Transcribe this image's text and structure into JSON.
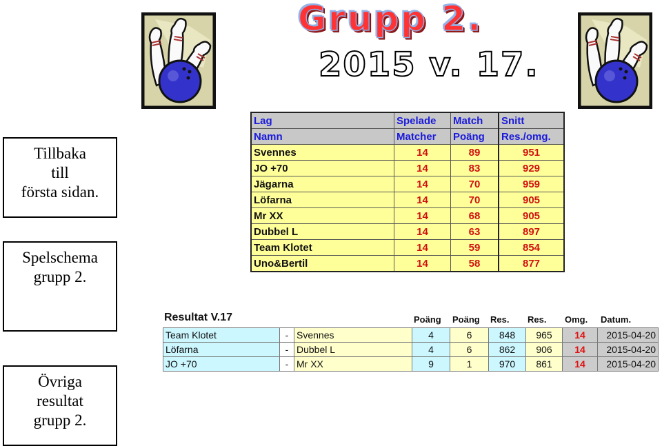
{
  "nav": {
    "back": [
      "Tillbaka",
      "till",
      "första sidan."
    ],
    "schedule": [
      "Spelschema",
      "grupp 2."
    ],
    "other_results": [
      "Övriga",
      "resultat",
      "grupp 2."
    ]
  },
  "header": {
    "title": "Grupp 2.",
    "subtitle": "2015 v. 17.",
    "clipart_icon": "bowling-ball-and-pins"
  },
  "standings": {
    "header_row1": [
      "Lag",
      "Spelade",
      "Match",
      "Snitt"
    ],
    "header_row2": [
      "Namn",
      "Matcher",
      "Poäng",
      "Res./omg."
    ],
    "rows": [
      {
        "team": "Svennes",
        "played": "14",
        "points": "89",
        "avg": "951"
      },
      {
        "team": "JO +70",
        "played": "14",
        "points": "83",
        "avg": "929"
      },
      {
        "team": "Jägarna",
        "played": "14",
        "points": "70",
        "avg": "959"
      },
      {
        "team": "Löfarna",
        "played": "14",
        "points": "70",
        "avg": "905"
      },
      {
        "team": "Mr XX",
        "played": "14",
        "points": "68",
        "avg": "905"
      },
      {
        "team": "Dubbel L",
        "played": "14",
        "points": "63",
        "avg": "897"
      },
      {
        "team": "Team Klotet",
        "played": "14",
        "points": "59",
        "avg": "854"
      },
      {
        "team": "Uno&Bertil",
        "played": "14",
        "points": "58",
        "avg": "877"
      }
    ]
  },
  "results": {
    "title": "Resultat V.17",
    "headers": [
      "Poäng",
      "Poäng",
      "Res.",
      "Res.",
      "Omg.",
      "Datum."
    ],
    "rows": [
      {
        "home": "Team Klotet",
        "sep": "-",
        "away": "Svennes",
        "p1": "4",
        "p2": "6",
        "r1": "848",
        "r2": "965",
        "round": "14",
        "date": "2015-04-20"
      },
      {
        "home": "Löfarna",
        "sep": "-",
        "away": "Dubbel L",
        "p1": "4",
        "p2": "6",
        "r1": "862",
        "r2": "906",
        "round": "14",
        "date": "2015-04-20"
      },
      {
        "home": "JO +70",
        "sep": "-",
        "away": "Mr XX",
        "p1": "9",
        "p2": "1",
        "r1": "970",
        "r2": "861",
        "round": "14",
        "date": "2015-04-20"
      }
    ]
  },
  "colors": {
    "header_text": "#1a1adc",
    "value_red": "#d01010",
    "row_yellow": "#ffff99",
    "cell_blue": "#ccf7ff",
    "cell_grey": "#cccccc"
  }
}
